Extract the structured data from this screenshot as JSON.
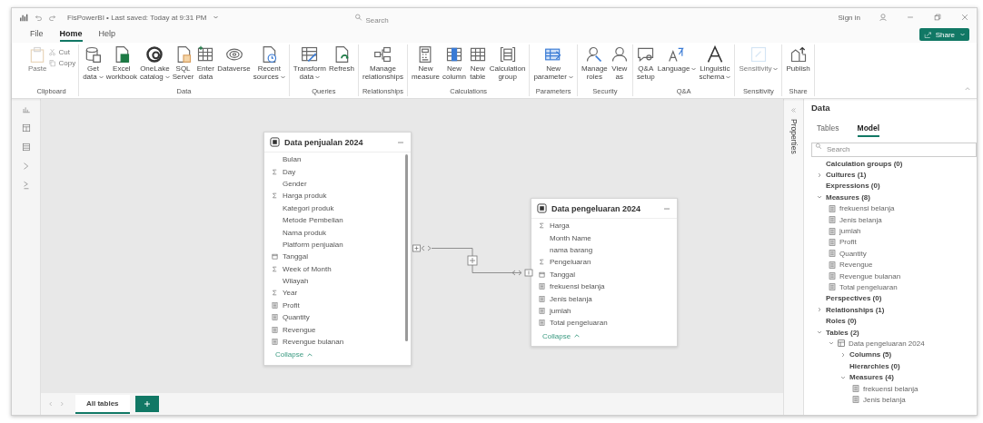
{
  "title_bar": {
    "title": "FisPowerBI • Last saved: Today at 9:31 PM",
    "search_placeholder": "Search",
    "sign_in": "Sign in"
  },
  "menu": [
    {
      "label": "File",
      "selected": false
    },
    {
      "label": "Home",
      "selected": true
    },
    {
      "label": "Help",
      "selected": false
    }
  ],
  "share_button": "Share",
  "ribbon": [
    {
      "label": "Clipboard",
      "items": [
        {
          "kind": "large",
          "lines": [
            "Paste"
          ],
          "disabled": true,
          "dropdown": false
        },
        {
          "kind": "small",
          "lines": [
            "Cut"
          ],
          "disabled": true,
          "dropdown": false
        },
        {
          "kind": "small",
          "lines": [
            "Copy"
          ],
          "disabled": true,
          "dropdown": false
        }
      ]
    },
    {
      "label": "Data",
      "items": [
        {
          "kind": "large",
          "lines": [
            "Get",
            "data"
          ],
          "disabled": false,
          "dropdown": true
        },
        {
          "kind": "large",
          "lines": [
            "Excel",
            "workbook"
          ],
          "disabled": false,
          "dropdown": false
        },
        {
          "kind": "large",
          "lines": [
            "OneLake",
            "catalog"
          ],
          "disabled": false,
          "dropdown": true
        },
        {
          "kind": "large",
          "lines": [
            "SQL",
            "Server"
          ],
          "disabled": false,
          "dropdown": false
        },
        {
          "kind": "large",
          "lines": [
            "Enter",
            "data"
          ],
          "disabled": false,
          "dropdown": false
        },
        {
          "kind": "large",
          "lines": [
            "Dataverse"
          ],
          "disabled": false,
          "dropdown": false
        },
        {
          "kind": "large",
          "lines": [
            "Recent",
            "sources"
          ],
          "disabled": false,
          "dropdown": true
        }
      ]
    },
    {
      "label": "Queries",
      "items": [
        {
          "kind": "large",
          "lines": [
            "Transform",
            "data"
          ],
          "disabled": false,
          "dropdown": true
        },
        {
          "kind": "large",
          "lines": [
            "Refresh"
          ],
          "disabled": false,
          "dropdown": false
        }
      ]
    },
    {
      "label": "Relationships",
      "items": [
        {
          "kind": "large",
          "lines": [
            "Manage",
            "relationships"
          ],
          "disabled": false,
          "dropdown": false
        }
      ]
    },
    {
      "label": "Calculations",
      "items": [
        {
          "kind": "large",
          "lines": [
            "New",
            "measure"
          ],
          "disabled": false,
          "dropdown": false
        },
        {
          "kind": "large",
          "lines": [
            "New",
            "column"
          ],
          "disabled": false,
          "dropdown": false
        },
        {
          "kind": "large",
          "lines": [
            "New",
            "table"
          ],
          "disabled": false,
          "dropdown": false
        },
        {
          "kind": "large",
          "lines": [
            "Calculation",
            "group"
          ],
          "disabled": false,
          "dropdown": false
        }
      ]
    },
    {
      "label": "Parameters",
      "items": [
        {
          "kind": "large",
          "lines": [
            "New",
            "parameter"
          ],
          "disabled": false,
          "dropdown": true
        }
      ]
    },
    {
      "label": "Security",
      "items": [
        {
          "kind": "large",
          "lines": [
            "Manage",
            "roles"
          ],
          "disabled": false,
          "dropdown": false
        },
        {
          "kind": "large",
          "lines": [
            "View",
            "as"
          ],
          "disabled": false,
          "dropdown": false
        }
      ]
    },
    {
      "label": "Q&A",
      "items": [
        {
          "kind": "large",
          "lines": [
            "Q&A",
            "setup"
          ],
          "disabled": false,
          "dropdown": false
        },
        {
          "kind": "large",
          "lines": [
            "Language"
          ],
          "disabled": false,
          "dropdown": true
        },
        {
          "kind": "large",
          "lines": [
            "Linguistic",
            "schema"
          ],
          "disabled": false,
          "dropdown": true
        }
      ]
    },
    {
      "label": "Sensitivity",
      "items": [
        {
          "kind": "large",
          "lines": [
            "Sensitivity"
          ],
          "disabled": true,
          "dropdown": true
        }
      ]
    },
    {
      "label": "Share",
      "items": [
        {
          "kind": "large",
          "lines": [
            "Publish"
          ],
          "disabled": false,
          "dropdown": false
        }
      ]
    }
  ],
  "tables": [
    {
      "title": "Data penjualan 2024",
      "collapse": "Collapse",
      "fields": [
        {
          "name": "Bulan",
          "kind": "text"
        },
        {
          "name": "Day",
          "kind": "number"
        },
        {
          "name": "Gender",
          "kind": "text"
        },
        {
          "name": "Harga produk",
          "kind": "number"
        },
        {
          "name": "Kategori produk",
          "kind": "text"
        },
        {
          "name": "Metode Pembelian",
          "kind": "text"
        },
        {
          "name": "Nama produk",
          "kind": "text"
        },
        {
          "name": "Platform penjualan",
          "kind": "text"
        },
        {
          "name": "Tanggal",
          "kind": "date"
        },
        {
          "name": "Week of Month",
          "kind": "number"
        },
        {
          "name": "Wilayah",
          "kind": "text"
        },
        {
          "name": "Year",
          "kind": "number"
        },
        {
          "name": "Profit",
          "kind": "measure"
        },
        {
          "name": "Quantity",
          "kind": "measure"
        },
        {
          "name": "Revengue",
          "kind": "measure"
        },
        {
          "name": "Revengue bulanan",
          "kind": "measure"
        }
      ]
    },
    {
      "title": "Data pengeluaran 2024",
      "collapse": "Collapse",
      "fields": [
        {
          "name": "Harga",
          "kind": "number"
        },
        {
          "name": "Month Name",
          "kind": "text"
        },
        {
          "name": "nama barang",
          "kind": "text"
        },
        {
          "name": "Pengeluaran",
          "kind": "number"
        },
        {
          "name": "Tanggal",
          "kind": "date"
        },
        {
          "name": "frekuensi belanja",
          "kind": "measure"
        },
        {
          "name": "Jenis belanja",
          "kind": "measure"
        },
        {
          "name": "jumlah",
          "kind": "measure"
        },
        {
          "name": "Total pengeluaran",
          "kind": "measure"
        }
      ]
    }
  ],
  "page_tabs": [
    {
      "label": "All tables",
      "selected": true
    }
  ],
  "properties_label": "Properties",
  "data_pane": {
    "title": "Data",
    "tabs": [
      {
        "label": "Tables",
        "selected": false
      },
      {
        "label": "Model",
        "selected": true
      }
    ],
    "search_placeholder": "Search",
    "tree": [
      {
        "label": "Calculation groups (0)",
        "kind": "folder"
      },
      {
        "label": "Cultures (1)",
        "kind": "group",
        "expanded": false
      },
      {
        "label": "Expressions (0)",
        "kind": "folder"
      },
      {
        "label": "Measures (8)",
        "kind": "group",
        "expanded": true,
        "children": [
          {
            "label": "frekuensi belanja",
            "kind": "measure"
          },
          {
            "label": "Jenis belanja",
            "kind": "measure"
          },
          {
            "label": "jumlah",
            "kind": "measure"
          },
          {
            "label": "Profit",
            "kind": "measure"
          },
          {
            "label": "Quantity",
            "kind": "measure"
          },
          {
            "label": "Revengue",
            "kind": "measure"
          },
          {
            "label": "Revengue bulanan",
            "kind": "measure"
          },
          {
            "label": "Total pengeluaran",
            "kind": "measure"
          }
        ]
      },
      {
        "label": "Perspectives (0)",
        "kind": "folder"
      },
      {
        "label": "Relationships (1)",
        "kind": "group",
        "expanded": false
      },
      {
        "label": "Roles (0)",
        "kind": "folder"
      },
      {
        "label": "Tables (2)",
        "kind": "group",
        "expanded": true,
        "children": [
          {
            "label": "Data pengeluaran 2024",
            "kind": "table",
            "expanded": true,
            "children": [
              {
                "label": "Columns (5)",
                "kind": "group",
                "expanded": false
              },
              {
                "label": "Hierarchies (0)",
                "kind": "folder"
              },
              {
                "label": "Measures (4)",
                "kind": "group",
                "expanded": true,
                "children": [
                  {
                    "label": "frekuensi belanja",
                    "kind": "measure"
                  },
                  {
                    "label": "Jenis belanja",
                    "kind": "measure"
                  }
                ]
              }
            ]
          }
        ]
      }
    ]
  }
}
